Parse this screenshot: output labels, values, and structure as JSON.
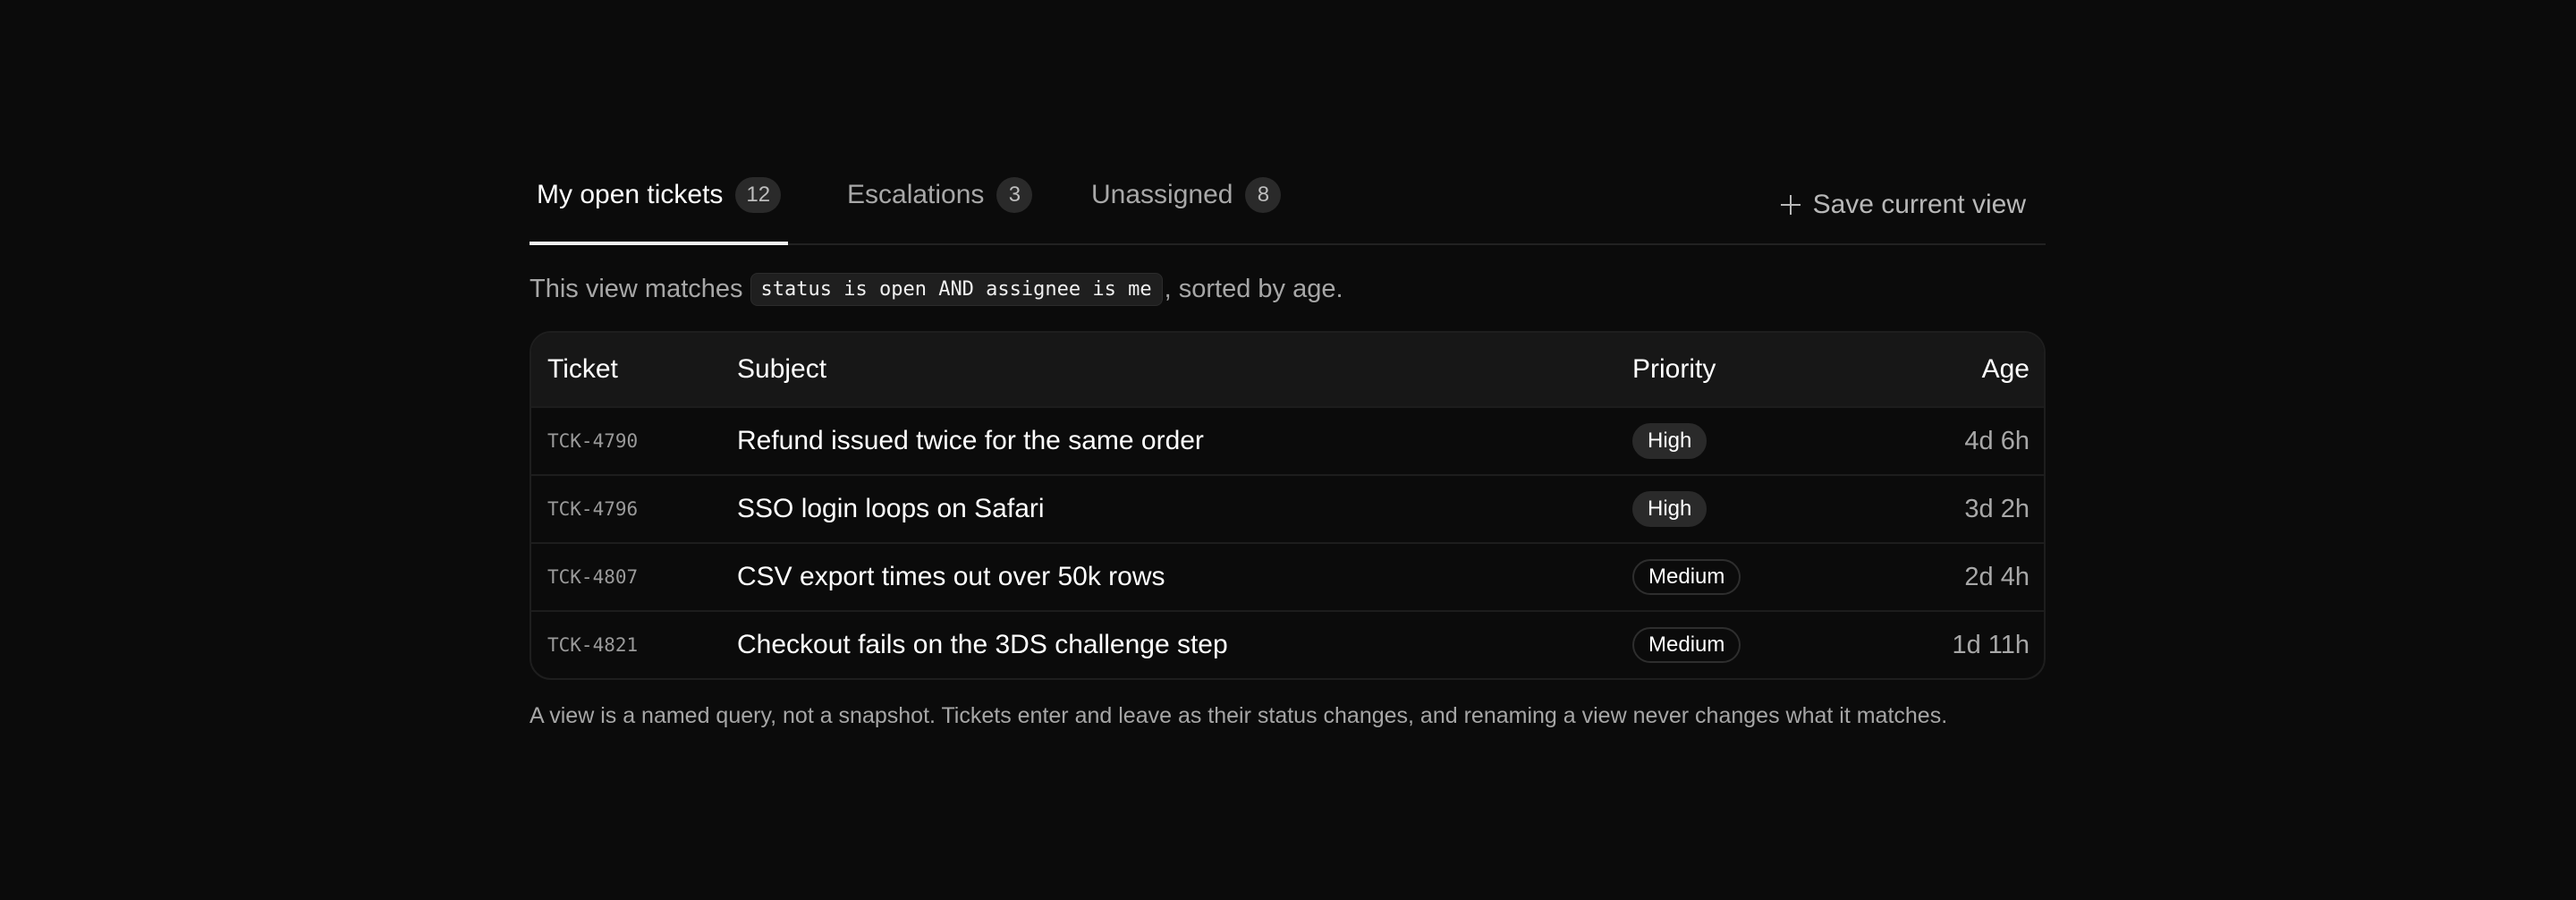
{
  "tabs": [
    {
      "label": "My open tickets",
      "count": "12",
      "active": true
    },
    {
      "label": "Escalations",
      "count": "3",
      "active": false
    },
    {
      "label": "Unassigned",
      "count": "8",
      "active": false
    }
  ],
  "save_view": {
    "label": "Save current view",
    "icon": "plus-icon"
  },
  "description": {
    "prefix": "This view matches",
    "query": "status is open AND assignee is me",
    "suffix": ", sorted by age."
  },
  "table": {
    "columns": [
      "Ticket",
      "Subject",
      "Priority",
      "Age"
    ],
    "rows": [
      {
        "ticket": "TCK-4790",
        "subject": "Refund issued twice for the same order",
        "priority": "High",
        "age": "4d 6h"
      },
      {
        "ticket": "TCK-4796",
        "subject": "SSO login loops on Safari",
        "priority": "High",
        "age": "3d 2h"
      },
      {
        "ticket": "TCK-4807",
        "subject": "CSV export times out over 50k rows",
        "priority": "Medium",
        "age": "2d 4h"
      },
      {
        "ticket": "TCK-4821",
        "subject": "Checkout fails on the 3DS challenge step",
        "priority": "Medium",
        "age": "1d 11h"
      }
    ]
  },
  "footnote": "A view is a named query, not a snapshot. Tickets enter and leave as their status changes, and renaming a view never changes what it matches.",
  "colors": {
    "background": "#0b0b0b",
    "accent": "#f2f2f2",
    "muted_text": "#a7a7a7"
  }
}
